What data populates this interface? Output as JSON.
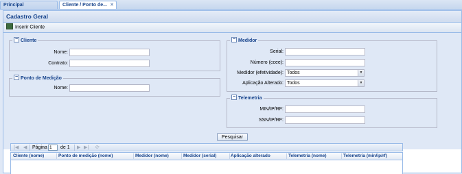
{
  "tabs": [
    {
      "label": "Principal"
    },
    {
      "label": "Cliente / Ponto de...",
      "close": "✕"
    }
  ],
  "panel": {
    "title": "Cadastro Geral"
  },
  "toolbar": {
    "insert_label": "Inserir Cliente"
  },
  "cliente": {
    "legend": "Cliente",
    "nome_label": "Nome:",
    "nome_value": "",
    "contrato_label": "Contrato:",
    "contrato_value": ""
  },
  "ponto": {
    "legend": "Ponto de Medição",
    "nome_label": "Nome:",
    "nome_value": ""
  },
  "medidor": {
    "legend": "Medidor",
    "serial_label": "Serial:",
    "serial_value": "",
    "numero_label": "Número (ccee):",
    "numero_value": "",
    "efetividade_label": "Medidor (efetividade):",
    "efetividade_value": "Todos",
    "aplicacao_label": "Aplicação Alterado:",
    "aplicacao_value": "Todos"
  },
  "telemetria": {
    "legend": "Telemetria",
    "min_label": "MIN/IP/RF:",
    "min_value": "",
    "ssn_label": "SSN/IP/RF:",
    "ssn_value": ""
  },
  "search": {
    "label": "Pesquisar"
  },
  "pager": {
    "page_label": "Página",
    "page_value": "1",
    "of_label": "de 1"
  },
  "grid": {
    "columns": [
      "Cliente (nome)",
      "Ponto de medição (nome)",
      "Medidor (nome)",
      "Medidor (serial)",
      "Aplicação alterado",
      "Telemetria (nome)",
      "Telemetria (min/ip/rf)"
    ]
  }
}
